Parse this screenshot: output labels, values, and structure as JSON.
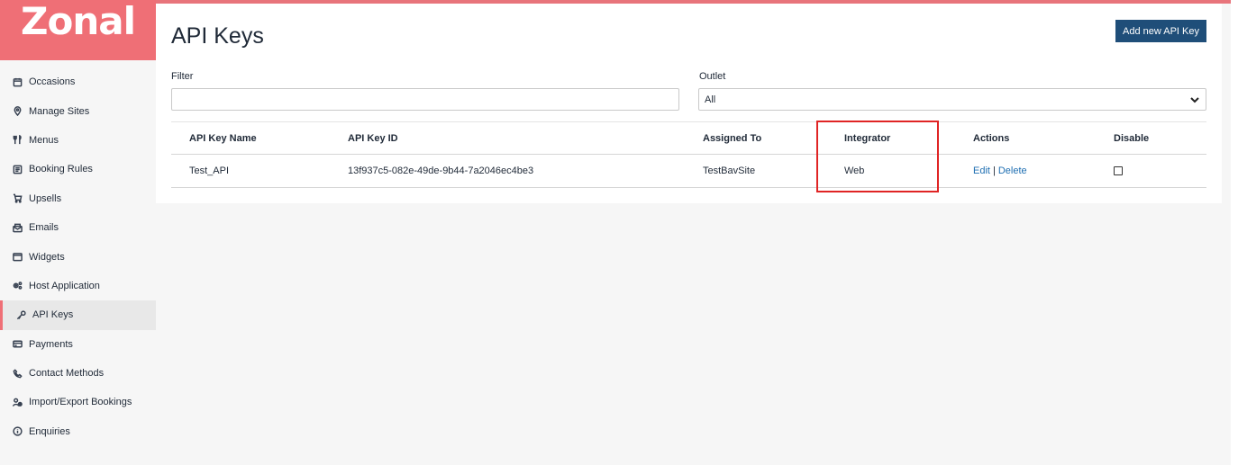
{
  "brand": {
    "logo_text": "Zonal",
    "accent": "#ef6f76",
    "primary_button": "#1f4e79",
    "highlight": "#e02424"
  },
  "sidebar": {
    "items": [
      {
        "label": "Occasions",
        "icon": "calendar-icon",
        "active": false
      },
      {
        "label": "Manage Sites",
        "icon": "location-pin-icon",
        "active": false
      },
      {
        "label": "Menus",
        "icon": "cutlery-icon",
        "active": false
      },
      {
        "label": "Booking Rules",
        "icon": "rules-list-icon",
        "active": false
      },
      {
        "label": "Upsells",
        "icon": "cart-icon",
        "active": false
      },
      {
        "label": "Emails",
        "icon": "envelope-icon",
        "active": false
      },
      {
        "label": "Widgets",
        "icon": "widget-window-icon",
        "active": false
      },
      {
        "label": "Host Application",
        "icon": "host-app-icon",
        "active": false
      },
      {
        "label": "API Keys",
        "icon": "key-icon",
        "active": true
      },
      {
        "label": "Payments",
        "icon": "credit-card-icon",
        "active": false
      },
      {
        "label": "Contact Methods",
        "icon": "phone-icon",
        "active": false
      },
      {
        "label": "Import/Export Bookings",
        "icon": "users-icon",
        "active": false
      },
      {
        "label": "Enquiries",
        "icon": "info-icon",
        "active": false
      }
    ]
  },
  "header": {
    "title": "API Keys",
    "add_button_label": "Add new API Key"
  },
  "filters": {
    "filter_label": "Filter",
    "filter_value": "",
    "outlet_label": "Outlet",
    "outlet_selected": "All"
  },
  "table": {
    "columns": [
      "API Key Name",
      "API Key ID",
      "Assigned To",
      "Integrator",
      "Actions",
      "Disable"
    ],
    "rows": [
      {
        "name": "Test_API",
        "key_id": "13f937c5-082e-49de-9b44-7a2046ec4be3",
        "assigned_to": "TestBavSite",
        "integrator": "Web",
        "edit_label": "Edit",
        "separator": "|",
        "delete_label": "Delete",
        "disabled": false
      }
    ]
  }
}
